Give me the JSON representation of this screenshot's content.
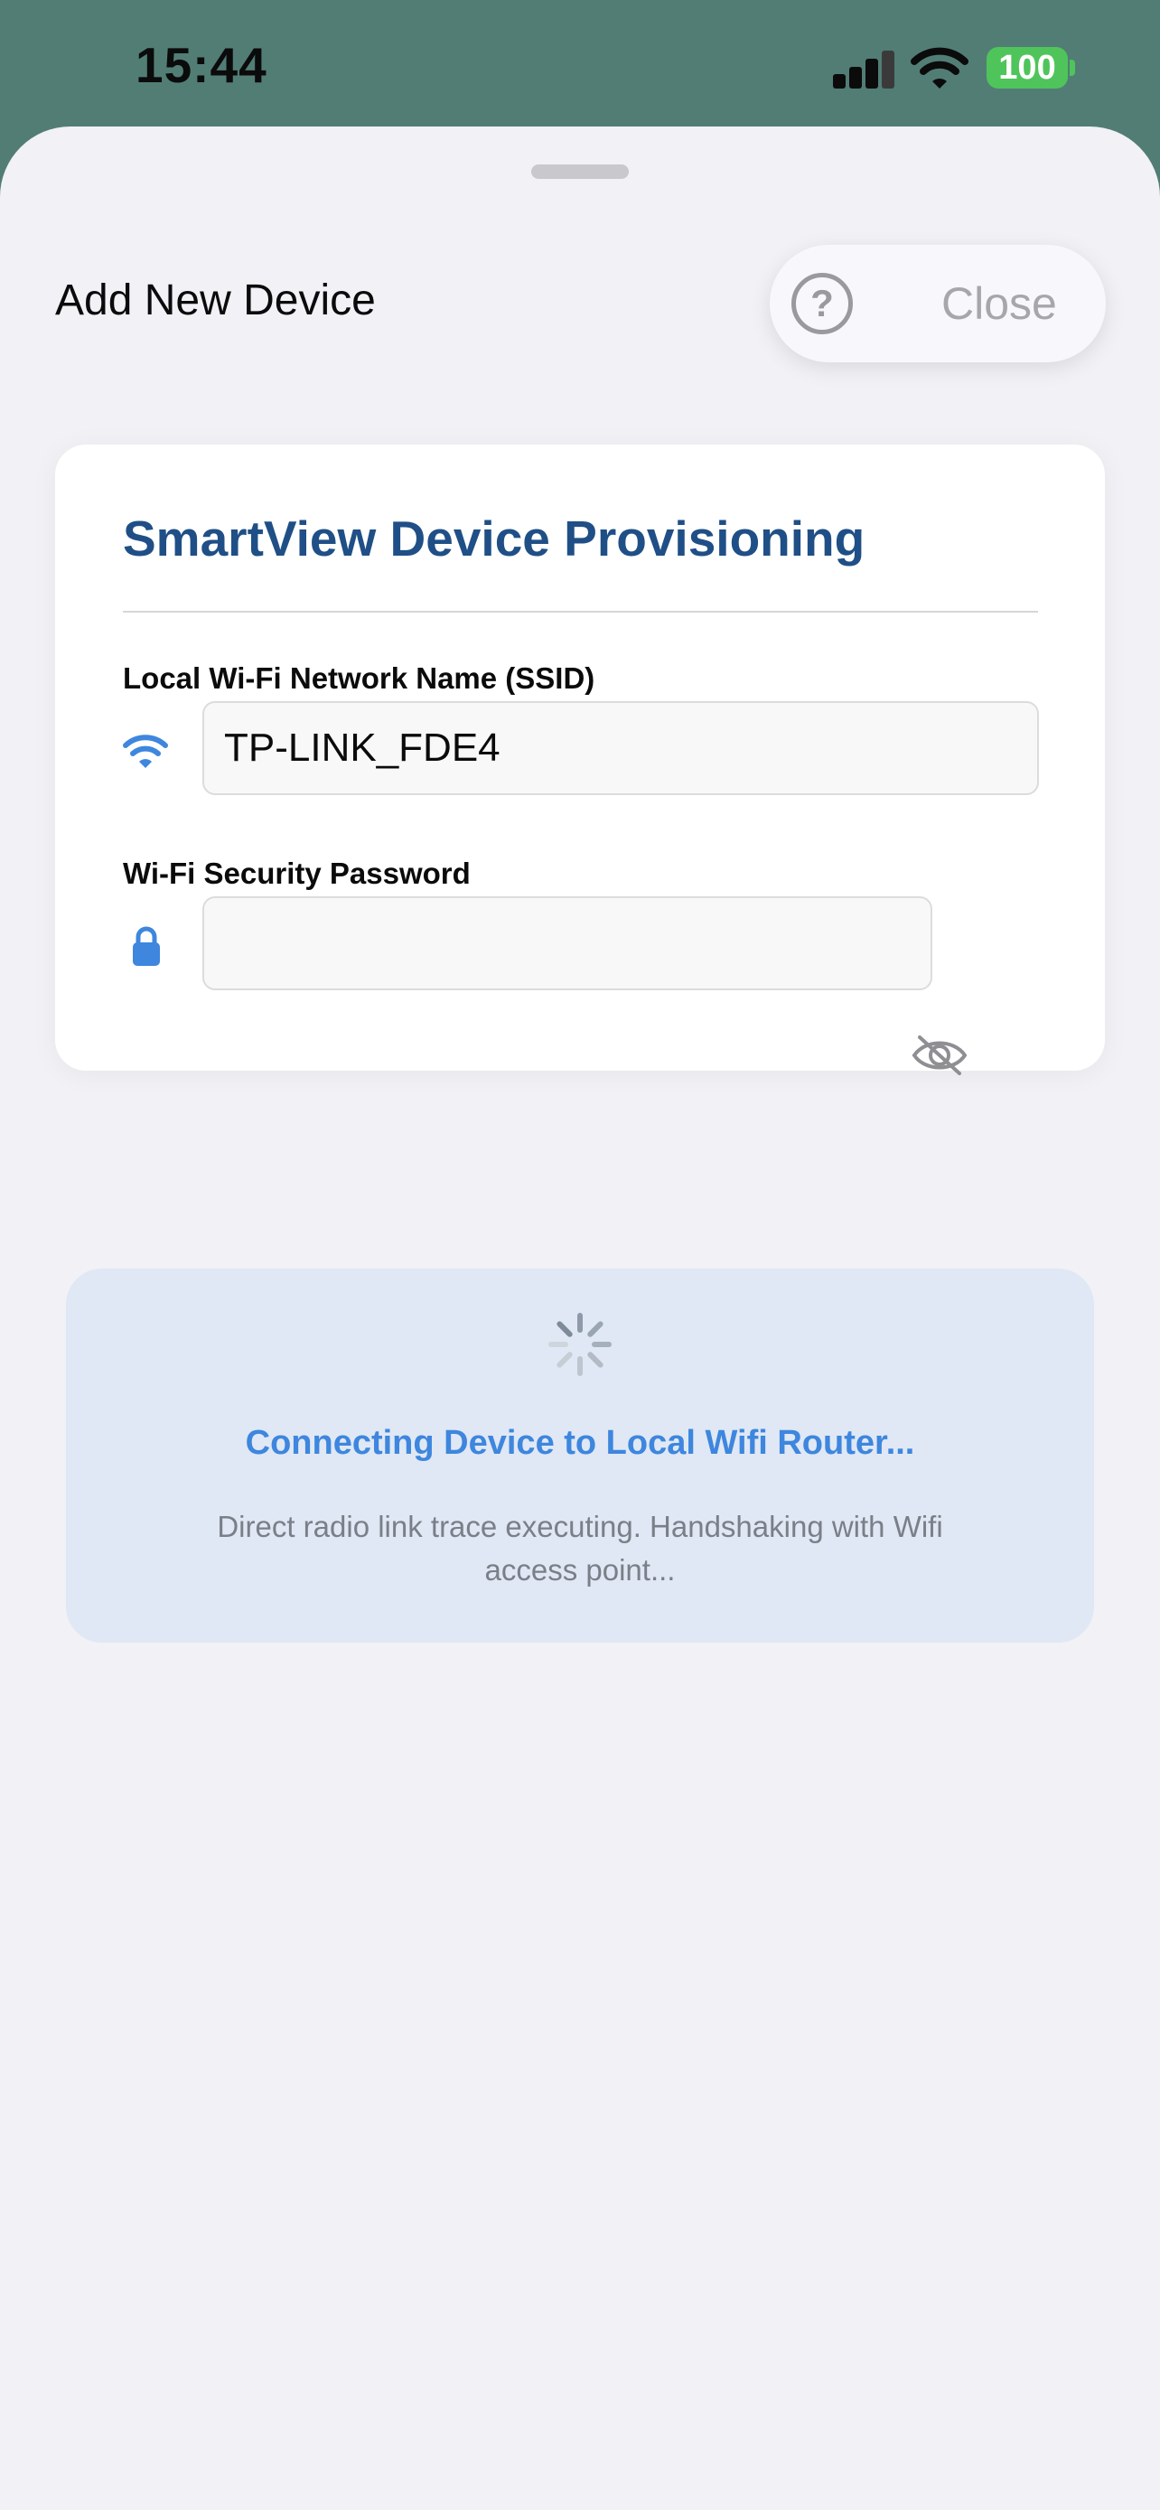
{
  "status_bar": {
    "time": "15:44",
    "battery": "100"
  },
  "sheet": {
    "title": "Add New Device",
    "close_label": "Close",
    "help_icon": "question-circle-icon",
    "help_symbol": "?"
  },
  "card": {
    "title": "SmartView Device Provisioning",
    "ssid_label": "Local Wi-Fi Network Name (SSID)",
    "ssid_value": "TP-LINK_FDE4",
    "ssid_icon": "wifi-icon",
    "password_label": "Wi-Fi Security Password",
    "password_value": "",
    "password_icon": "lock-icon",
    "visibility_icon": "eye-slash-icon"
  },
  "progress": {
    "title": "Connecting Device to Local Wifi Router...",
    "description": "Direct radio link trace executing. Handshaking with Wifi access point...",
    "icon": "spinner-icon"
  },
  "colors": {
    "accent": "#3e86de",
    "title_blue": "#1f4f86",
    "battery_green": "#4fc45b",
    "backdrop": "#517d75"
  }
}
